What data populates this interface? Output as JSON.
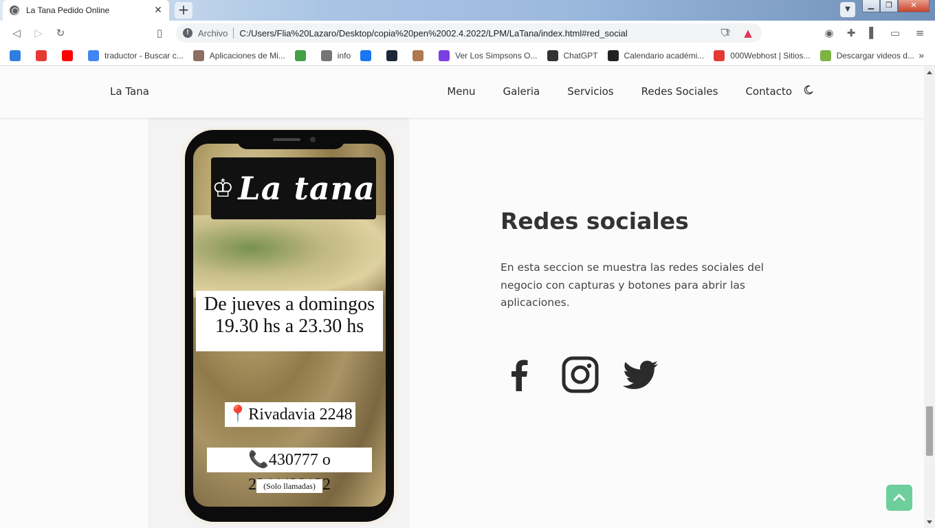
{
  "browser": {
    "tab_title": "La Tana Pedido Online",
    "tab_close": "✕",
    "new_tab": "+",
    "url_scheme": "Archivo",
    "url": "C:/Users/Flia%20Lazaro/Desktop/copia%20pen%2002.4.2022/LPM/LaTana/index.html#red_social",
    "bookmarks": [
      {
        "label": "",
        "color": "#2f7de0"
      },
      {
        "label": "",
        "color": "#e53935"
      },
      {
        "label": "",
        "color": "#ff0000"
      },
      {
        "label": "traductor - Buscar c...",
        "color": "#4285f4"
      },
      {
        "label": "Aplicaciones de Mi...",
        "color": "#8d6e63"
      },
      {
        "label": "",
        "color": "#43a047"
      },
      {
        "label": "info",
        "color": "#757575"
      },
      {
        "label": "",
        "color": "#1877f2"
      },
      {
        "label": "",
        "color": "#1b2838"
      },
      {
        "label": "",
        "color": "#b07850"
      },
      {
        "label": "Ver Los Simpsons O...",
        "color": "#7b3fe4"
      },
      {
        "label": "ChatGPT",
        "color": "#333333"
      },
      {
        "label": "Calendario académi...",
        "color": "#222222"
      },
      {
        "label": "000Webhost | Sitios...",
        "color": "#e53935"
      },
      {
        "label": "Descargar videos d...",
        "color": "#7cb342"
      }
    ],
    "bookmarks_more": "»"
  },
  "nav": {
    "brand": "La Tana",
    "links": [
      "Menu",
      "Galeria",
      "Servicios",
      "Redes Sociales",
      "Contacto"
    ]
  },
  "poster": {
    "logo_text": "La tana",
    "hours_line1": "De jueves a domingos",
    "hours_line2": "19.30 hs a 23.30 hs",
    "address": "📍Rivadavia 2248",
    "phone": "📞430777 o 2344439132",
    "note": "(Solo llamadas)"
  },
  "section": {
    "title": "Redes sociales",
    "description": "En esta seccion se muestra las redes sociales del negocio con capturas y botones para abrir las aplicaciones.",
    "icons": [
      "facebook-icon",
      "instagram-icon",
      "twitter-icon"
    ]
  },
  "colors": {
    "accent_green": "#6dcf9b",
    "text_dark": "#333333"
  }
}
